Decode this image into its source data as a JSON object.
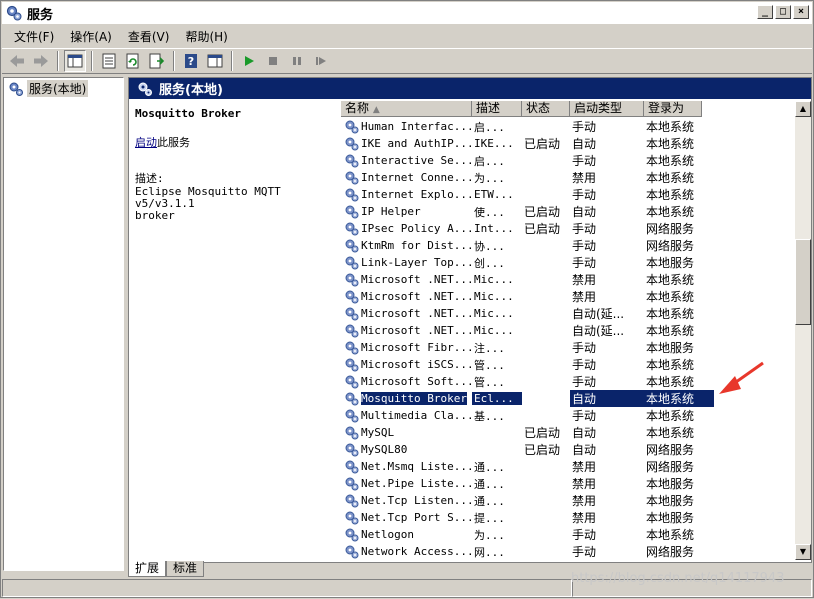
{
  "window": {
    "title": "服务"
  },
  "menu": [
    "文件(F)",
    "操作(A)",
    "查看(V)",
    "帮助(H)"
  ],
  "toolbar": {
    "buttons": [
      "back-icon",
      "forward-icon",
      "show-tree-icon",
      "properties-icon",
      "refresh-icon",
      "export-icon",
      "help-icon",
      "show-console-icon",
      "start-icon",
      "stop-icon",
      "pause-icon",
      "restart-icon"
    ]
  },
  "tree": {
    "root_label": "服务(本地)"
  },
  "pane": {
    "title": "服务(本地)"
  },
  "detail": {
    "service_name": "Mosquitto Broker",
    "start_link": "启动",
    "start_suffix": "此服务",
    "desc_label": "描述:",
    "desc_text": "Eclipse Mosquitto MQTT v5/v3.1.1\nbroker"
  },
  "columns": [
    "名称",
    "描述",
    "状态",
    "启动类型",
    "登录为"
  ],
  "rows": [
    {
      "name": "Human Interfac...",
      "desc": "启...",
      "status": "",
      "startup": "手动",
      "logon": "本地系统"
    },
    {
      "name": "IKE and AuthIP...",
      "desc": "IKE...",
      "status": "已启动",
      "startup": "自动",
      "logon": "本地系统"
    },
    {
      "name": "Interactive Se...",
      "desc": "启...",
      "status": "",
      "startup": "手动",
      "logon": "本地系统"
    },
    {
      "name": "Internet Conne...",
      "desc": "为...",
      "status": "",
      "startup": "禁用",
      "logon": "本地系统"
    },
    {
      "name": "Internet Explo...",
      "desc": "ETW...",
      "status": "",
      "startup": "手动",
      "logon": "本地系统"
    },
    {
      "name": "IP Helper",
      "desc": "使...",
      "status": "已启动",
      "startup": "自动",
      "logon": "本地系统"
    },
    {
      "name": "IPsec Policy A...",
      "desc": "Int...",
      "status": "已启动",
      "startup": "手动",
      "logon": "网络服务"
    },
    {
      "name": "KtmRm for Dist...",
      "desc": "协...",
      "status": "",
      "startup": "手动",
      "logon": "网络服务"
    },
    {
      "name": "Link-Layer Top...",
      "desc": "创...",
      "status": "",
      "startup": "手动",
      "logon": "本地服务"
    },
    {
      "name": "Microsoft .NET...",
      "desc": "Mic...",
      "status": "",
      "startup": "禁用",
      "logon": "本地系统"
    },
    {
      "name": "Microsoft .NET...",
      "desc": "Mic...",
      "status": "",
      "startup": "禁用",
      "logon": "本地系统"
    },
    {
      "name": "Microsoft .NET...",
      "desc": "Mic...",
      "status": "",
      "startup": "自动(延...",
      "logon": "本地系统"
    },
    {
      "name": "Microsoft .NET...",
      "desc": "Mic...",
      "status": "",
      "startup": "自动(延...",
      "logon": "本地系统"
    },
    {
      "name": "Microsoft Fibr...",
      "desc": "注...",
      "status": "",
      "startup": "手动",
      "logon": "本地服务"
    },
    {
      "name": "Microsoft iSCS...",
      "desc": "管...",
      "status": "",
      "startup": "手动",
      "logon": "本地系统"
    },
    {
      "name": "Microsoft Soft...",
      "desc": "管...",
      "status": "",
      "startup": "手动",
      "logon": "本地系统"
    },
    {
      "name": "Mosquitto Broker",
      "desc": "Ecl...",
      "status": "",
      "startup": "自动",
      "logon": "本地系统",
      "selected": true
    },
    {
      "name": "Multimedia Cla...",
      "desc": "基...",
      "status": "",
      "startup": "手动",
      "logon": "本地系统"
    },
    {
      "name": "MySQL",
      "desc": "",
      "status": "已启动",
      "startup": "自动",
      "logon": "本地系统"
    },
    {
      "name": "MySQL80",
      "desc": "",
      "status": "已启动",
      "startup": "自动",
      "logon": "网络服务"
    },
    {
      "name": "Net.Msmq Liste...",
      "desc": "通...",
      "status": "",
      "startup": "禁用",
      "logon": "网络服务"
    },
    {
      "name": "Net.Pipe Liste...",
      "desc": "通...",
      "status": "",
      "startup": "禁用",
      "logon": "本地服务"
    },
    {
      "name": "Net.Tcp Listen...",
      "desc": "通...",
      "status": "",
      "startup": "禁用",
      "logon": "本地服务"
    },
    {
      "name": "Net.Tcp Port S...",
      "desc": "提...",
      "status": "",
      "startup": "禁用",
      "logon": "本地服务"
    },
    {
      "name": "Netlogon",
      "desc": "为...",
      "status": "",
      "startup": "手动",
      "logon": "本地系统"
    },
    {
      "name": "Network Access...",
      "desc": "网...",
      "status": "",
      "startup": "手动",
      "logon": "网络服务"
    }
  ],
  "tabs": [
    "扩展",
    "标准"
  ],
  "watermark": "https://blog.csdn.net/q14117943",
  "colors": {
    "selection": "#0a246a",
    "annotation_arrow": "#e8372b"
  }
}
